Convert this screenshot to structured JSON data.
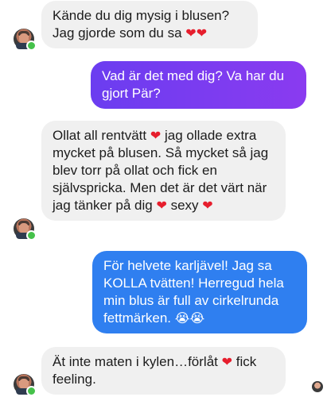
{
  "messages": [
    {
      "from": "them",
      "text": "Kände du dig mysig i blusen? Jag gjorde som du sa",
      "suffix": "❤❤"
    },
    {
      "from": "me",
      "text": "Vad är det med dig? Va har du gjort Pär?"
    },
    {
      "from": "them",
      "text_a": "Ollat all rentvätt",
      "text_b": "jag ollade extra mycket på blusen. Så mycket så jag blev torr på ollat och fick en självspricka. Men det är det värt när jag tänker på dig",
      "text_c": "sexy",
      "heart": "❤"
    },
    {
      "from": "me",
      "text": "För helvete karljävel! Jag sa KOLLA  tvätten! Herregud hela min blus är full av cirkelrunda fettmärken.",
      "emoji": "😭😭"
    },
    {
      "from": "them",
      "text": "Ät inte maten i kylen…förlåt",
      "heart": "❤",
      "text_2": "fick feeling."
    }
  ],
  "colors": {
    "incoming_bubble": "#f0f0f0",
    "outgoing_purple": "#7a3df0",
    "outgoing_blue": "#2f7ff0",
    "online": "#45c14a",
    "heart": "#e61e2d"
  },
  "icons": {
    "avatar": "avatar-icon",
    "online": "online-status-icon",
    "read_receipt": "read-receipt-avatar-icon"
  }
}
